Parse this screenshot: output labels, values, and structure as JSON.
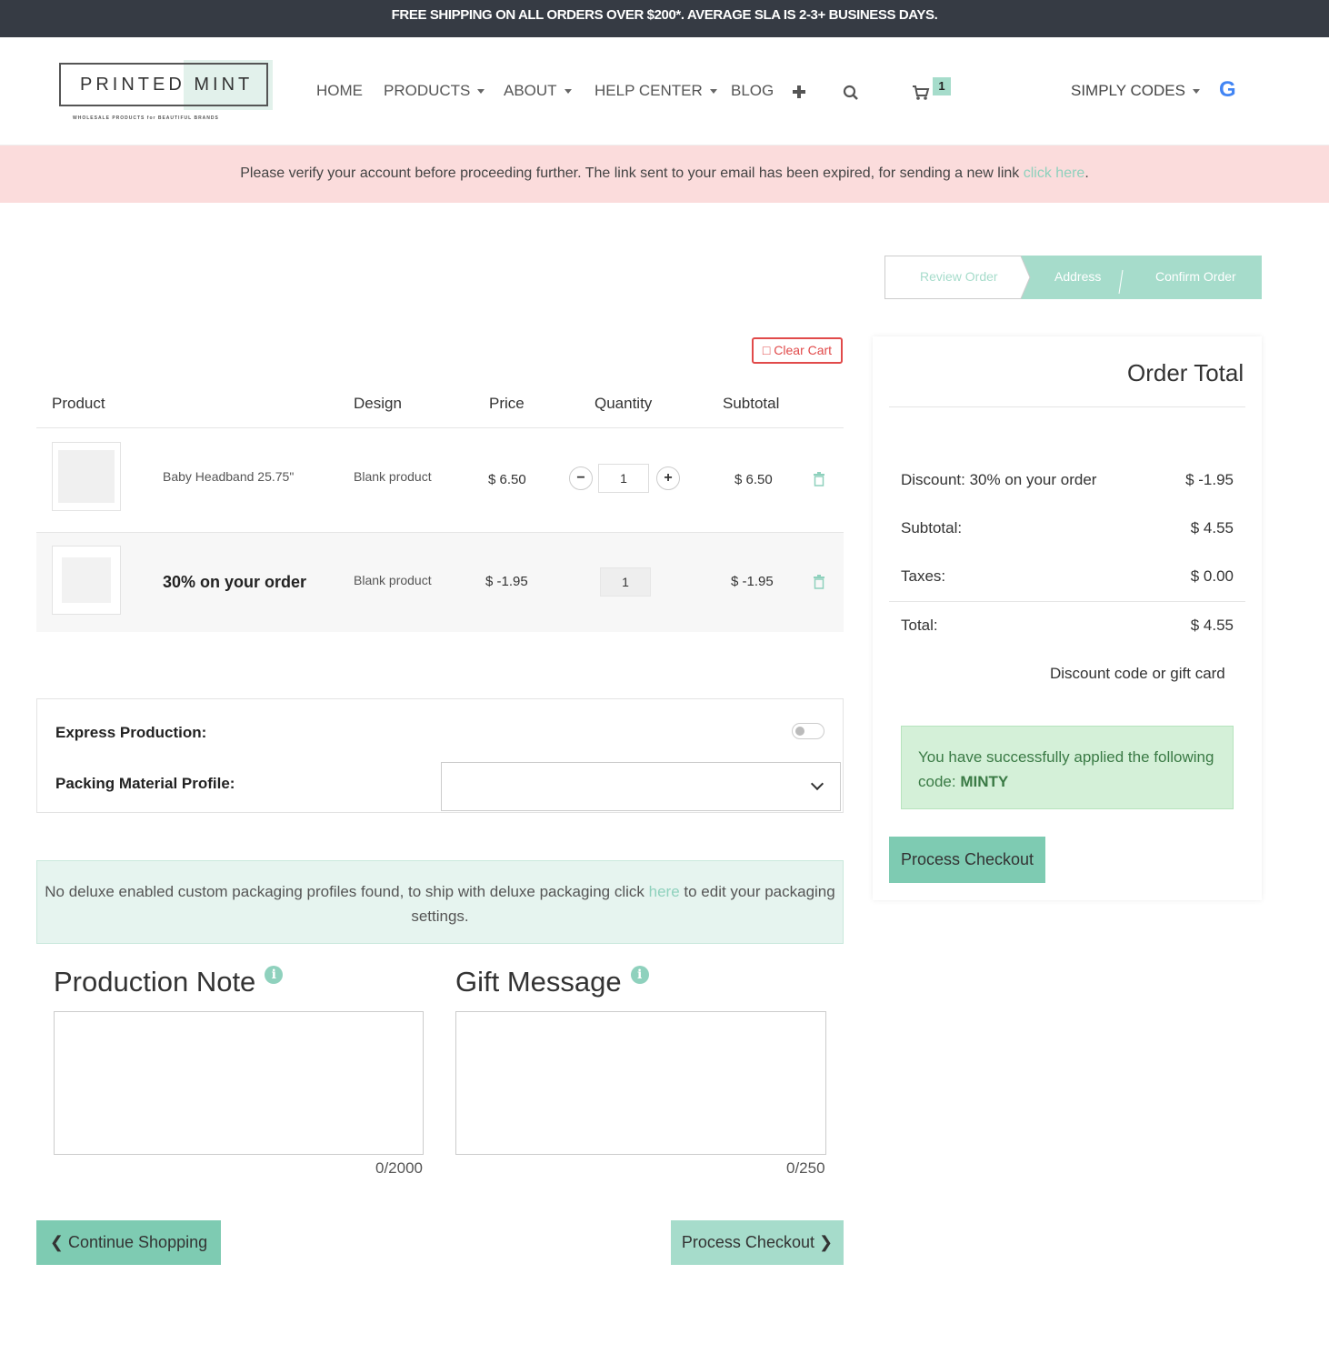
{
  "topbar": {
    "text": "FREE SHIPPING ON ALL ORDERS OVER $200*. AVERAGE SLA IS 2-3+ BUSINESS DAYS."
  },
  "logo": {
    "part1": "PRINTED",
    "part2": "MINT",
    "tagline": "WHOLESALE PRODUCTS for BEAUTIFUL BRANDS"
  },
  "nav": {
    "items": [
      "HOME",
      "PRODUCTS",
      "ABOUT",
      "HELP CENTER",
      "BLOG"
    ],
    "cart_count": "1",
    "account": "SIMPLY CODES",
    "google_letter": "G"
  },
  "verify_alert": {
    "text": "Please verify your account before proceeding further. The link sent to your email has been expired, for sending a new link ",
    "link": "click here",
    "end": "."
  },
  "steps": [
    "Review Order",
    "Address",
    "Confirm Order"
  ],
  "cart": {
    "clear_label": "Clear Cart",
    "headers": [
      "Product",
      "Design",
      "Price",
      "Quantity",
      "Subtotal"
    ],
    "rows": [
      {
        "name": "Baby Headband 25.75\"",
        "design": "Blank product",
        "price": "$ 6.50",
        "qty": "1",
        "subtotal": "$ 6.50"
      },
      {
        "name": "30% on your order",
        "design": "Blank product",
        "price": "$ -1.95",
        "qty": "1",
        "subtotal": "$ -1.95"
      }
    ]
  },
  "options": {
    "express_label": "Express Production:",
    "packing_label": "Packing Material Profile:"
  },
  "packaging_alert": {
    "pre": "No deluxe enabled custom packaging profiles found, to ship with deluxe packaging click ",
    "link": "here",
    "post": " to edit your packaging settings."
  },
  "notes": {
    "production_title": "Production Note",
    "production_count": "0/2000",
    "gift_title": "Gift Message",
    "gift_count": "0/250",
    "info_glyph": "i"
  },
  "buttons": {
    "continue": "Continue Shopping",
    "checkout": "Process Checkout"
  },
  "order_total": {
    "title": "Order Total",
    "lines": [
      {
        "label": "Discount: 30% on your order",
        "value": "$ -1.95"
      },
      {
        "label": "Subtotal:",
        "value": "$ 4.55"
      },
      {
        "label": "Taxes:",
        "value": "$ 0.00"
      },
      {
        "label": "Total:",
        "value": "$ 4.55"
      }
    ],
    "discount_link": "Discount code or gift card",
    "success_pre": "You have successfully applied the following code: ",
    "success_code": "MINTY",
    "checkout_label": "Process Checkout"
  },
  "colors": {
    "mint": "#7ecbb2",
    "topbar": "#363b44",
    "alert_pink": "#fbdcdc",
    "danger": "#e14a4a"
  }
}
